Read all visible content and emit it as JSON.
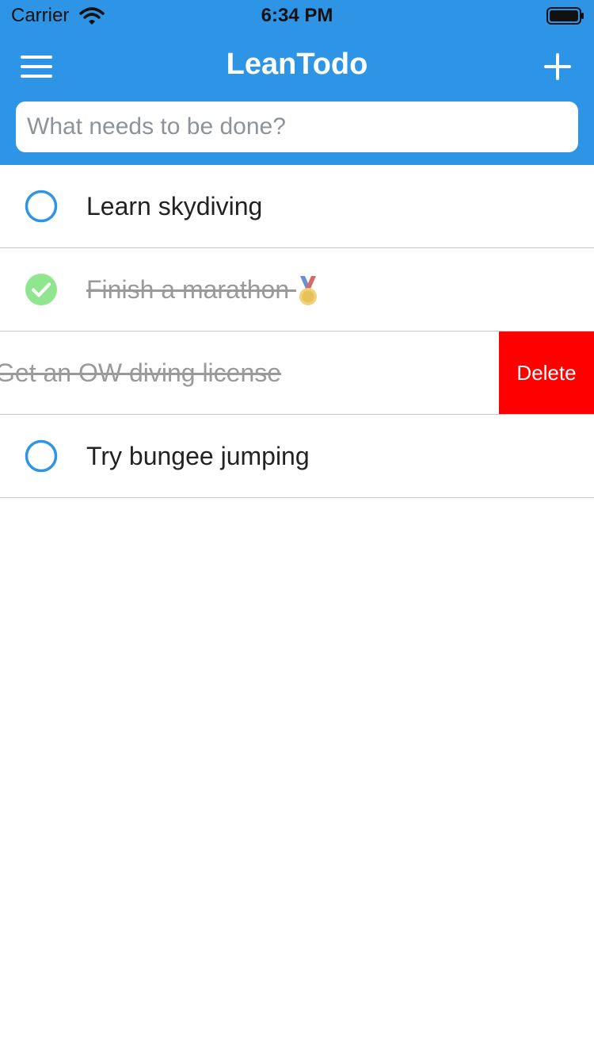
{
  "status_bar": {
    "carrier": "Carrier",
    "time": "6:34 PM"
  },
  "header": {
    "title": "LeanTodo",
    "background_color": "#2e95e6"
  },
  "new_todo": {
    "placeholder": "What needs to be done?",
    "value": ""
  },
  "todos": [
    {
      "text": "Learn skydiving",
      "completed": false
    },
    {
      "text": "Finish a marathon",
      "completed": true
    },
    {
      "text": "Get an OW diving license",
      "completed": true
    },
    {
      "text": "Try bungee jumping",
      "completed": false
    }
  ],
  "swipe_action": {
    "label": "Delete",
    "color": "#ff0000"
  },
  "colors": {
    "accent": "#2e95e6",
    "done_check": "#8fe68f",
    "open_circle": "#2e95e6"
  },
  "icons": [
    "wifi-icon",
    "battery-icon",
    "menu-icon",
    "plus-icon",
    "circle-icon",
    "checkmark-icon",
    "medal-icon"
  ]
}
